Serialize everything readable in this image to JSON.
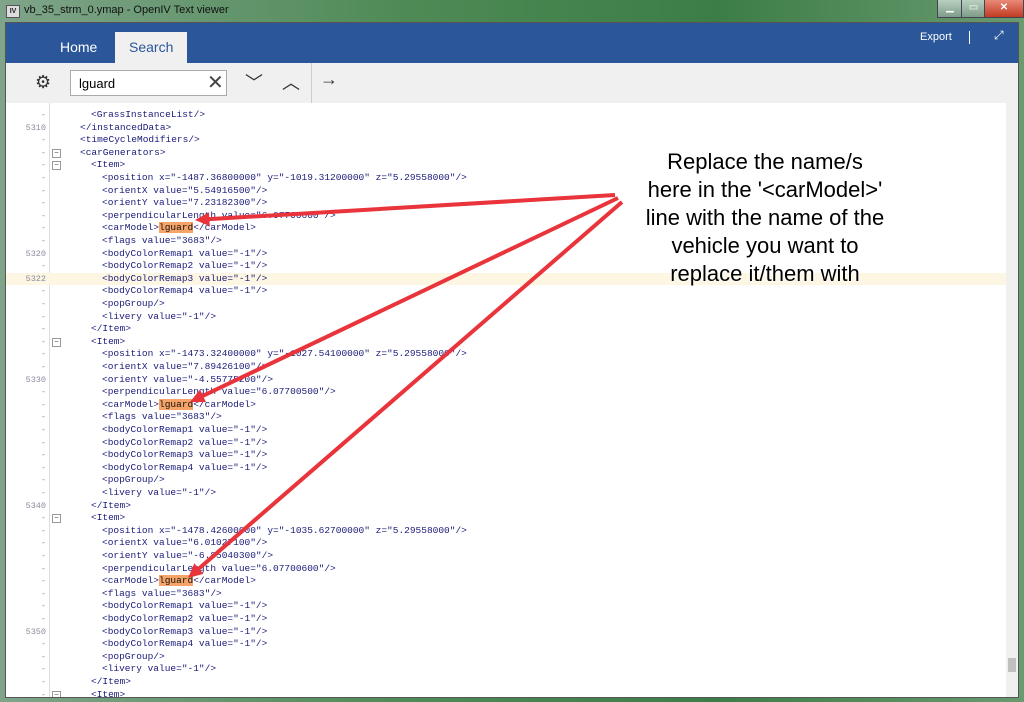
{
  "window": {
    "title": "vb_35_strm_0.ymap - OpenIV Text viewer",
    "icon": "IV"
  },
  "ribbon": {
    "tabs": [
      {
        "label": "Home"
      },
      {
        "label": "Search",
        "active": true
      }
    ],
    "export_label": "Export"
  },
  "toolbar": {
    "search_value": "lguard"
  },
  "editor": {
    "current_line": 5322,
    "highlight": "lguard",
    "lines": [
      {
        "n": "-",
        "i": 3,
        "t": "<GrassInstanceList/>"
      },
      {
        "n": "5310",
        "i": 2,
        "t": "</instancedData>"
      },
      {
        "n": "-",
        "i": 2,
        "t": "<timeCycleModifiers/>"
      },
      {
        "n": "-",
        "i": 2,
        "t": "<carGenerators>",
        "f": true
      },
      {
        "n": "-",
        "i": 3,
        "t": "<Item>",
        "f": true
      },
      {
        "n": "-",
        "i": 4,
        "t": "<position x=\"-1487.36800000\" y=\"-1019.31200000\" z=\"5.29558000\"/>"
      },
      {
        "n": "-",
        "i": 4,
        "t": "<orientX value=\"5.54916500\"/>"
      },
      {
        "n": "-",
        "i": 4,
        "t": "<orientY value=\"7.23182300\"/>"
      },
      {
        "n": "-",
        "i": 4,
        "t": "<perpendicularLength value=\"6.07700600\"/>"
      },
      {
        "n": "-",
        "i": 4,
        "t": "<carModel>",
        "h": "lguard",
        "a": "</carModel>"
      },
      {
        "n": "-",
        "i": 4,
        "t": "<flags value=\"3683\"/>"
      },
      {
        "n": "5320",
        "i": 4,
        "t": "<bodyColorRemap1 value=\"-1\"/>"
      },
      {
        "n": "-",
        "i": 4,
        "t": "<bodyColorRemap2 value=\"-1\"/>"
      },
      {
        "n": "5322",
        "i": 4,
        "t": "<bodyColorRemap3 value=\"-1\"/>"
      },
      {
        "n": "-",
        "i": 4,
        "t": "<bodyColorRemap4 value=\"-1\"/>"
      },
      {
        "n": "-",
        "i": 4,
        "t": "<popGroup/>"
      },
      {
        "n": "-",
        "i": 4,
        "t": "<livery value=\"-1\"/>"
      },
      {
        "n": "-",
        "i": 3,
        "t": "</Item>"
      },
      {
        "n": "-",
        "i": 3,
        "t": "<Item>",
        "f": true
      },
      {
        "n": "-",
        "i": 4,
        "t": "<position x=\"-1473.32400000\" y=\"-1027.54100000\" z=\"5.29558000\"/>"
      },
      {
        "n": "-",
        "i": 4,
        "t": "<orientX value=\"7.89426100\"/>"
      },
      {
        "n": "5330",
        "i": 4,
        "t": "<orientY value=\"-4.55775200\"/>"
      },
      {
        "n": "-",
        "i": 4,
        "t": "<perpendicularLength value=\"6.07700500\"/>"
      },
      {
        "n": "-",
        "i": 4,
        "t": "<carModel>",
        "h": "lguard",
        "a": "</carModel>"
      },
      {
        "n": "-",
        "i": 4,
        "t": "<flags value=\"3683\"/>"
      },
      {
        "n": "-",
        "i": 4,
        "t": "<bodyColorRemap1 value=\"-1\"/>"
      },
      {
        "n": "-",
        "i": 4,
        "t": "<bodyColorRemap2 value=\"-1\"/>"
      },
      {
        "n": "-",
        "i": 4,
        "t": "<bodyColorRemap3 value=\"-1\"/>"
      },
      {
        "n": "-",
        "i": 4,
        "t": "<bodyColorRemap4 value=\"-1\"/>"
      },
      {
        "n": "-",
        "i": 4,
        "t": "<popGroup/>"
      },
      {
        "n": "-",
        "i": 4,
        "t": "<livery value=\"-1\"/>"
      },
      {
        "n": "5340",
        "i": 3,
        "t": "</Item>"
      },
      {
        "n": "-",
        "i": 3,
        "t": "<Item>",
        "f": true
      },
      {
        "n": "-",
        "i": 4,
        "t": "<position x=\"-1478.42600000\" y=\"-1035.62700000\" z=\"5.29558000\"/>"
      },
      {
        "n": "-",
        "i": 4,
        "t": "<orientX value=\"6.01027100\"/>"
      },
      {
        "n": "-",
        "i": 4,
        "t": "<orientY value=\"-6.85040300\"/>"
      },
      {
        "n": "-",
        "i": 4,
        "t": "<perpendicularLength value=\"6.07700600\"/>"
      },
      {
        "n": "-",
        "i": 4,
        "t": "<carModel>",
        "h": "lguard",
        "a": "</carModel>"
      },
      {
        "n": "-",
        "i": 4,
        "t": "<flags value=\"3683\"/>"
      },
      {
        "n": "-",
        "i": 4,
        "t": "<bodyColorRemap1 value=\"-1\"/>"
      },
      {
        "n": "-",
        "i": 4,
        "t": "<bodyColorRemap2 value=\"-1\"/>"
      },
      {
        "n": "5350",
        "i": 4,
        "t": "<bodyColorRemap3 value=\"-1\"/>"
      },
      {
        "n": "-",
        "i": 4,
        "t": "<bodyColorRemap4 value=\"-1\"/>"
      },
      {
        "n": "-",
        "i": 4,
        "t": "<popGroup/>"
      },
      {
        "n": "-",
        "i": 4,
        "t": "<livery value=\"-1\"/>"
      },
      {
        "n": "-",
        "i": 3,
        "t": "</Item>"
      },
      {
        "n": "-",
        "i": 3,
        "t": "<Item>",
        "f": true
      }
    ]
  },
  "annotation": {
    "lines": [
      "Replace the name/s",
      "here in the '<carModel>'",
      "line with the name of the",
      "vehicle you want to",
      "replace it/them with"
    ],
    "arrow_color": "#e8343a"
  },
  "colors": {
    "ribbon": "#2b579a",
    "highlight": "#f7a468",
    "code": "#1b1b7a"
  }
}
